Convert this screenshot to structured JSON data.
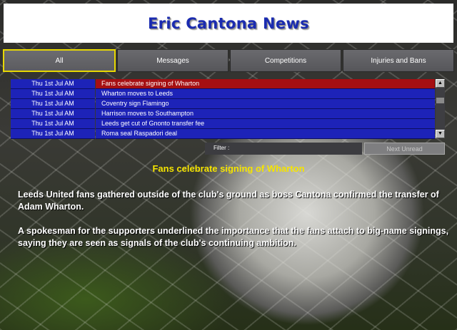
{
  "header": {
    "title": "Eric Cantona News"
  },
  "tabs": [
    {
      "label": "All",
      "active": true
    },
    {
      "label": "Messages",
      "active": false
    },
    {
      "label": "Competitions",
      "active": false
    },
    {
      "label": "Injuries and Bans",
      "active": false
    }
  ],
  "news": [
    {
      "date": "Thu 1st Jul AM",
      "headline": "Fans celebrate signing of Wharton",
      "selected": true
    },
    {
      "date": "Thu 1st Jul AM",
      "headline": "Wharton moves to Leeds",
      "selected": false
    },
    {
      "date": "Thu 1st Jul AM",
      "headline": "Coventry sign Flamingo",
      "selected": false
    },
    {
      "date": "Thu 1st Jul AM",
      "headline": "Harrison moves to Southampton",
      "selected": false
    },
    {
      "date": "Thu 1st Jul AM",
      "headline": "Leeds get cut of Gnonto transfer fee",
      "selected": false
    },
    {
      "date": "Thu 1st Jul AM",
      "headline": "Roma seal Raspadori deal",
      "selected": false
    }
  ],
  "filter": {
    "label": "Filter :"
  },
  "next_unread": {
    "label": "Next Unread"
  },
  "article": {
    "title": "Fans celebrate signing of Wharton",
    "paragraphs": [
      "Leeds United fans gathered outside of the club's ground as boss Cantona confirmed the transfer of Adam Wharton.",
      "A spokesman for the supporters underlined the importance that the fans attach to big-name signings, saying they are seen as signals of the club's continuing ambition."
    ]
  },
  "colors": {
    "title": "#1a2bb0",
    "active_tab_border": "#e8d800",
    "row_bg": "#1d23b8",
    "selected_row_bg": "#a50f12",
    "article_title": "#f5e400"
  },
  "icons": {
    "scroll_up": "arrow-up-icon",
    "scroll_down": "arrow-down-icon"
  }
}
